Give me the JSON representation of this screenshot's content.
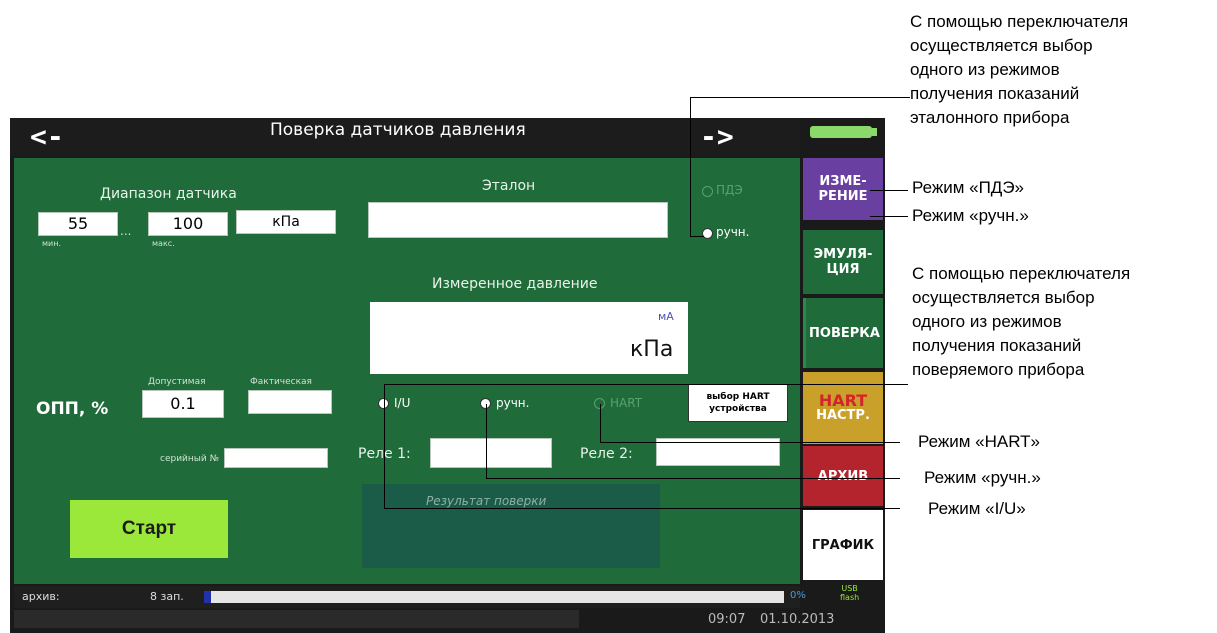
{
  "header": {
    "back_label": "<-",
    "title": "Поверка датчиков давления",
    "forward_label": "->"
  },
  "sensor_range": {
    "title": "Диапазон датчика",
    "min_value": "55",
    "min_label": "мин.",
    "max_value": "100",
    "max_label": "макс.",
    "dots": "...",
    "unit": "кПа"
  },
  "reference": {
    "title": "Эталон",
    "value": "",
    "mode_pde": "ПДЭ",
    "mode_manual": "ручн."
  },
  "measured": {
    "title": "Измеренное давление",
    "unit_small": "мА",
    "unit_big": "кПа"
  },
  "opp": {
    "label": "ОПП, %",
    "allowed_label": "Допустимая",
    "actual_label": "Фактическая",
    "allowed_value": "0.1",
    "actual_value": ""
  },
  "tested_modes": {
    "iu": "I/U",
    "manual": "ручн.",
    "hart": "HART",
    "hart_select_line1": "выбор HART",
    "hart_select_line2": "устройства"
  },
  "serial": {
    "label": "серийный №",
    "value": ""
  },
  "relay": {
    "relay1_label": "Реле 1:",
    "relay2_label": "Реле 2:",
    "relay1_value": "",
    "relay2_value": ""
  },
  "result": {
    "label": "Результат поверки"
  },
  "start_label": "Старт",
  "tabs": {
    "measure_1": "ИЗМЕ-",
    "measure_2": "РЕНИЕ",
    "emul_1": "ЭМУЛЯ-",
    "emul_2": "ЦИЯ",
    "verify": "ПОВЕРКА",
    "hart_1": "HART",
    "hart_2": "НАСТР.",
    "archive": "АРХИВ",
    "graph": "ГРАФИК",
    "usb_1": "USB",
    "usb_2": "flash"
  },
  "status": {
    "archive_label": "архив:",
    "records": "8 зап.",
    "progress_percent": 0,
    "progress_text": "0%",
    "time": "09:07",
    "date": "01.10.2013"
  },
  "annotations": {
    "top_block": [
      "С помощью переключателя",
      "осуществляется выбор",
      "одного из режимов",
      "получения показаний",
      "эталонного прибора"
    ],
    "mode_pde": "Режим «ПДЭ»",
    "mode_manual_ref": "Режим «ручн.»",
    "mid_block": [
      "С помощью переключателя",
      "осуществляется выбор",
      "одного из режимов",
      "получения показаний",
      "поверяемого прибора"
    ],
    "mode_hart": "Режим «HART»",
    "mode_manual_dev": "Режим «ручн.»",
    "mode_iu": "Режим «I/U»"
  },
  "colors": {
    "screen_bg": "#1f6b3a",
    "start_button": "#9be83a",
    "tab_measure": "#6a3fa2",
    "tab_emul": "#1f6b3a",
    "tab_verify": "#1f6b3a",
    "tab_hart": "#c9a12a",
    "tab_archive": "#b4242d",
    "tab_graph": "#ffffff"
  }
}
